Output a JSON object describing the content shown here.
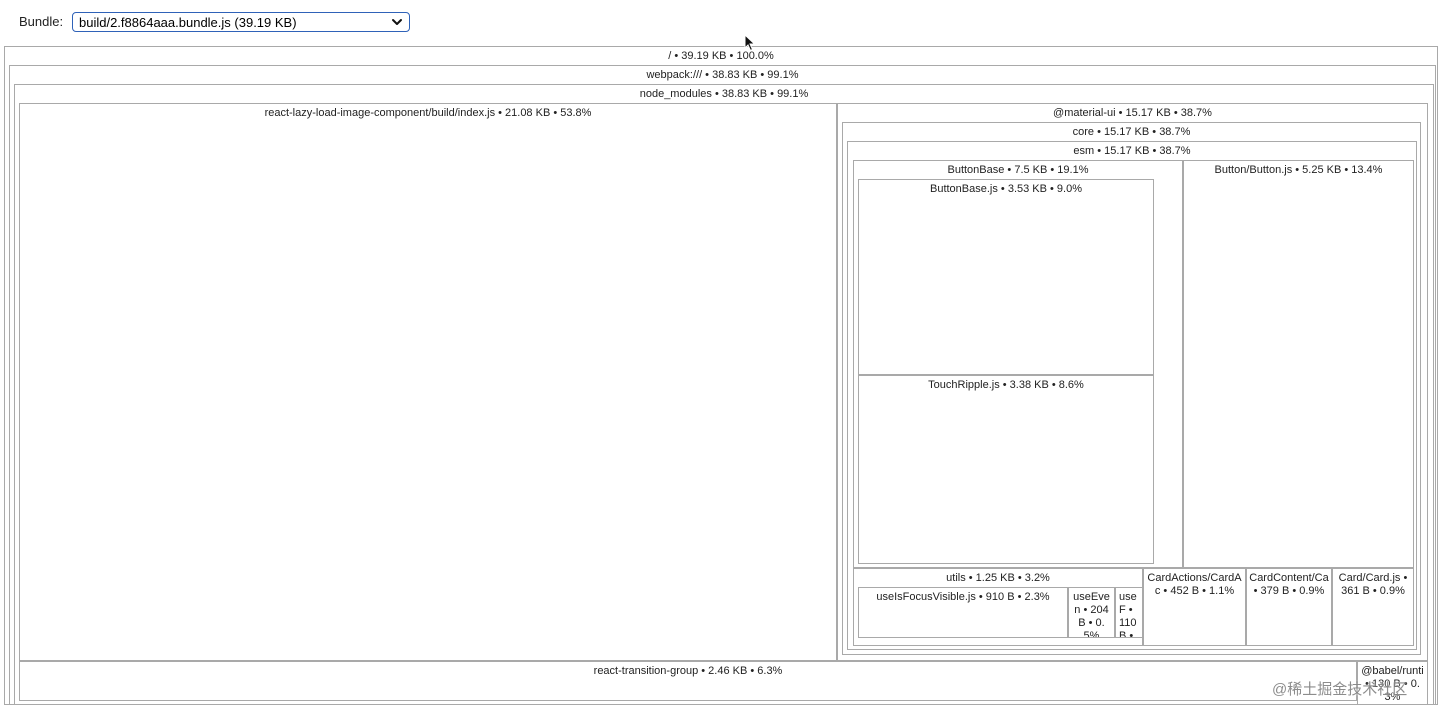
{
  "toolbar": {
    "bundle_label": "Bundle:",
    "bundle_selected": "build/2.f8864aaa.bundle.js (39.19 KB)",
    "dropdown_icon": "chevron-down-icon"
  },
  "treemap": {
    "root": "/ • 39.19 KB • 100.0%",
    "webpack": "webpack:/// • 38.83 KB • 99.1%",
    "node_modules": "node_modules • 38.83 KB • 99.1%",
    "react_lazy": "react-lazy-load-image-component/build/index.js • 21.08 KB • 53.8%",
    "material_ui": "@material-ui • 15.17 KB • 38.7%",
    "core": "core • 15.17 KB • 38.7%",
    "esm": "esm • 15.17 KB • 38.7%",
    "buttonbase": "ButtonBase • 7.5 KB • 19.1%",
    "buttonbase_js": "ButtonBase.js • 3.53 KB • 9.0%",
    "touchripple_js": "TouchRipple.js • 3.38 KB • 8.6%",
    "button_button": "Button/Button.js • 5.25 KB • 13.4%",
    "utils": "utils • 1.25 KB • 3.2%",
    "use_is_focus_visible": "useIsFocusVisible.js • 910 B • 2.3%",
    "use_event": "useEven • 204 B • 0.5%",
    "use_f": "useF • 110 B •",
    "card_actions": "CardActions/CardAc • 452 B • 1.1%",
    "card_content": "CardContent/Ca • 379 B • 0.9%",
    "card_card": "Card/Card.js • 361 B • 0.9%",
    "react_transition_group": "react-transition-group • 2.46 KB • 6.3%",
    "babel_runtime": "@babel/runti • 130 B • 0.3%"
  },
  "watermark": "@稀土掘金技术社区",
  "colors": {
    "select_border": "#2f62b8",
    "node_border": "#a9a9a9",
    "background": "#ffffff"
  }
}
